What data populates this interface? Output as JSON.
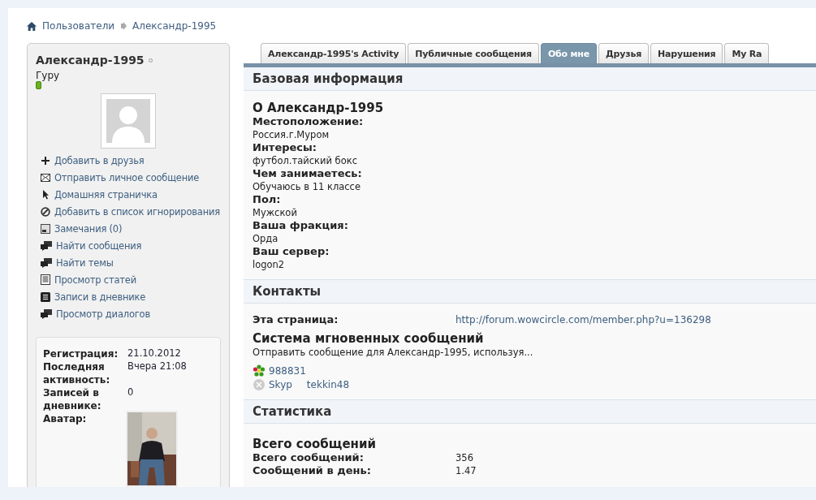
{
  "breadcrumb": {
    "items": [
      "Пользователи",
      "Александр-1995"
    ]
  },
  "profile": {
    "name": "Александр-1995",
    "online": false,
    "rank": "Гуру"
  },
  "actions": [
    {
      "kind": "add",
      "label": "Добавить в друзья"
    },
    {
      "kind": "message",
      "label": "Отправить личное сообщение"
    },
    {
      "kind": "homepage",
      "label": "Домашняя страничка"
    },
    {
      "kind": "ignore",
      "label": "Добавить в список игнорирования"
    },
    {
      "kind": "notes",
      "label": "Замечания (0)"
    },
    {
      "kind": "search",
      "label": "Найти сообщения"
    },
    {
      "kind": "search",
      "label": "Найти темы"
    },
    {
      "kind": "articles",
      "label": "Просмотр статей"
    },
    {
      "kind": "blog",
      "label": "Записи в дневнике"
    },
    {
      "kind": "search",
      "label": "Просмотр диалогов"
    }
  ],
  "mini_stats": [
    {
      "label": "Регистрация:",
      "value": "21.10.2012"
    },
    {
      "label": "Последняя активность:",
      "value": "Вчера 21:08"
    },
    {
      "label": "Записей в дневнике:",
      "value": "0"
    },
    {
      "label": "Аватар:",
      "kind": "picture"
    }
  ],
  "tabs": [
    {
      "label": "Александр-1995's Activity",
      "selected": false
    },
    {
      "label": "Публичные сообщения",
      "selected": false
    },
    {
      "label": "Обо мне",
      "selected": true
    },
    {
      "label": "Друзья",
      "selected": false
    },
    {
      "label": "Нарушения",
      "selected": false
    },
    {
      "label": "My Ra",
      "selected": false
    }
  ],
  "basic": {
    "title": "Базовая информация",
    "subtitle": "О Александр-1995",
    "fields": [
      {
        "label": "Местоположение:",
        "value": "Россия.г.Муром"
      },
      {
        "label": "Интересы:",
        "value": "футбол.тайский бокс"
      },
      {
        "label": "Чем занимаетесь:",
        "value": "Обучаюсь в 11 классе"
      },
      {
        "label": "Пол:",
        "value": "Мужской"
      },
      {
        "label": "Ваша фракция:",
        "value": "Орда"
      },
      {
        "label": "Ваш сервер:",
        "value": "logon2"
      }
    ]
  },
  "contacts": {
    "title": "Контакты",
    "page_label": "Эта страница:",
    "page_url": "http://forum.wowcircle.com/member.php?u=136298",
    "im_title": "Система мгновенных сообщений",
    "im_note": "Отправить сообщение для Александр-1995, используя...",
    "im": [
      {
        "kind": "icq",
        "parts": [
          "988831"
        ]
      },
      {
        "kind": "skype",
        "parts": [
          "Skyp",
          "tekkin48"
        ]
      }
    ]
  },
  "stats": {
    "title": "Статистика",
    "subtitle": "Всего сообщений",
    "rows": [
      {
        "label": "Всего сообщений:",
        "value": "356"
      },
      {
        "label": "Сообщений в день:",
        "value": "1.47"
      }
    ]
  }
}
